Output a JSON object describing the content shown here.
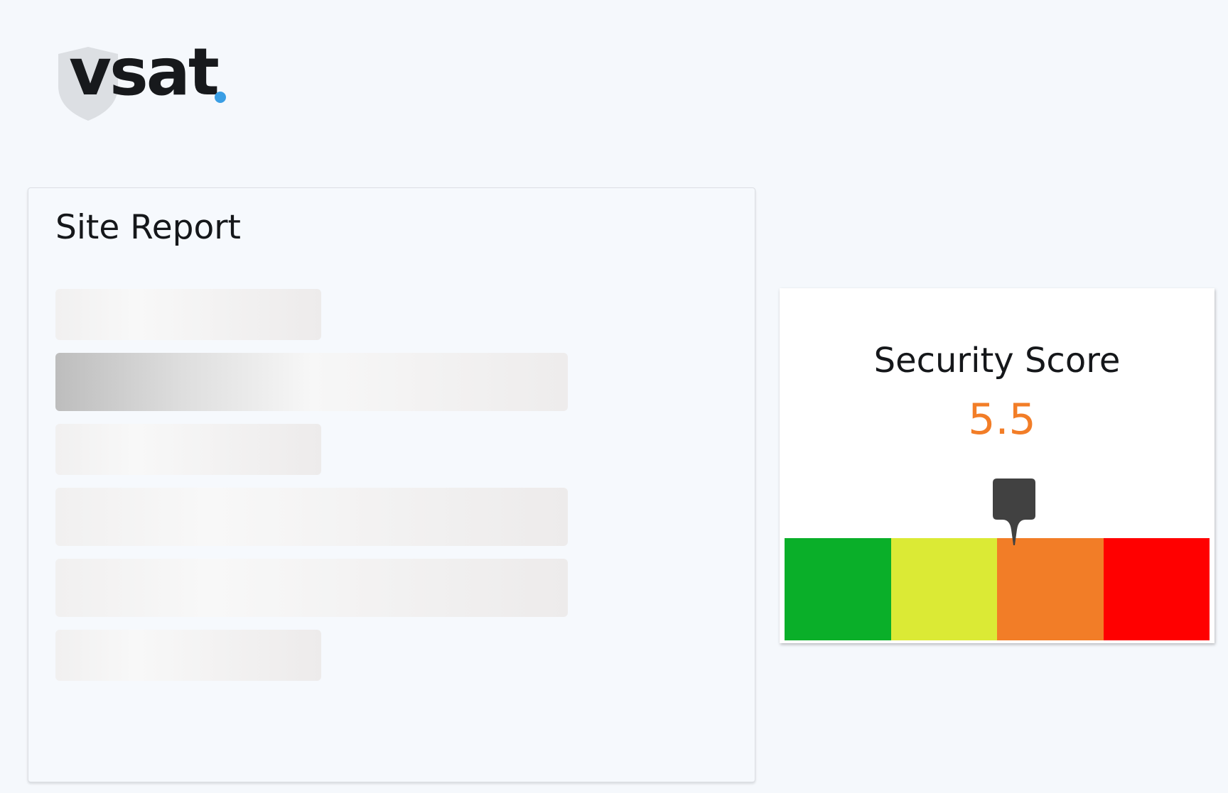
{
  "logo": {
    "wordmark": "vsat",
    "dot_color": "#3a9ee4"
  },
  "report": {
    "title": "Site Report",
    "loading_placeholders": 6
  },
  "score": {
    "title": "Security Score",
    "value": "5.5",
    "value_numeric": 5.5,
    "value_color": "#f27d27",
    "marker_position": 0.54,
    "scale_colors": [
      "#0aaf29",
      "#dbea35",
      "#f27d27",
      "#ff0000"
    ]
  }
}
